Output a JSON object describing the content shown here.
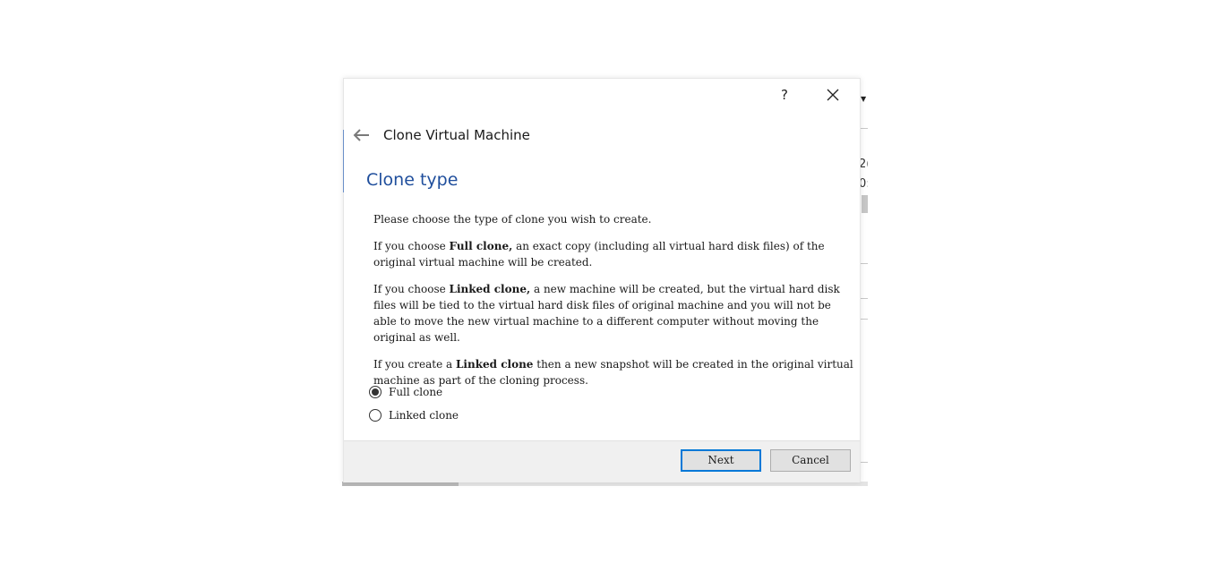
{
  "dialog": {
    "help_label": "?",
    "window_title": "Clone Virtual Machine",
    "page_title": "Clone type"
  },
  "description": {
    "intro": "Please choose the type of clone you wish to create.",
    "full": {
      "prefix": "If you choose ",
      "bold": "Full clone,",
      "suffix": " an exact copy (including all virtual hard disk files) of the original virtual machine will be created."
    },
    "linked": {
      "prefix": "If you choose ",
      "bold": "Linked clone,",
      "suffix": " a new machine will be created, but the virtual hard disk files will be tied to the virtual hard disk files of original machine and you will not be able to move the new virtual machine to a different computer without moving the original as well."
    },
    "snapshot": {
      "prefix": "If you create a ",
      "bold": "Linked clone",
      "suffix": " then a new snapshot will be created in the original virtual machine as part of the cloning process."
    }
  },
  "options": {
    "full_clone_label": "Full clone",
    "linked_clone_label": "Linked clone",
    "selected": "full_clone"
  },
  "footer": {
    "next_label": "Next",
    "cancel_label": "Cancel"
  },
  "background": {
    "partial_text_1": "2(",
    "partial_text_2": "0:"
  },
  "colors": {
    "title_blue": "#1f4e9c",
    "focus_blue": "#0078d7"
  }
}
